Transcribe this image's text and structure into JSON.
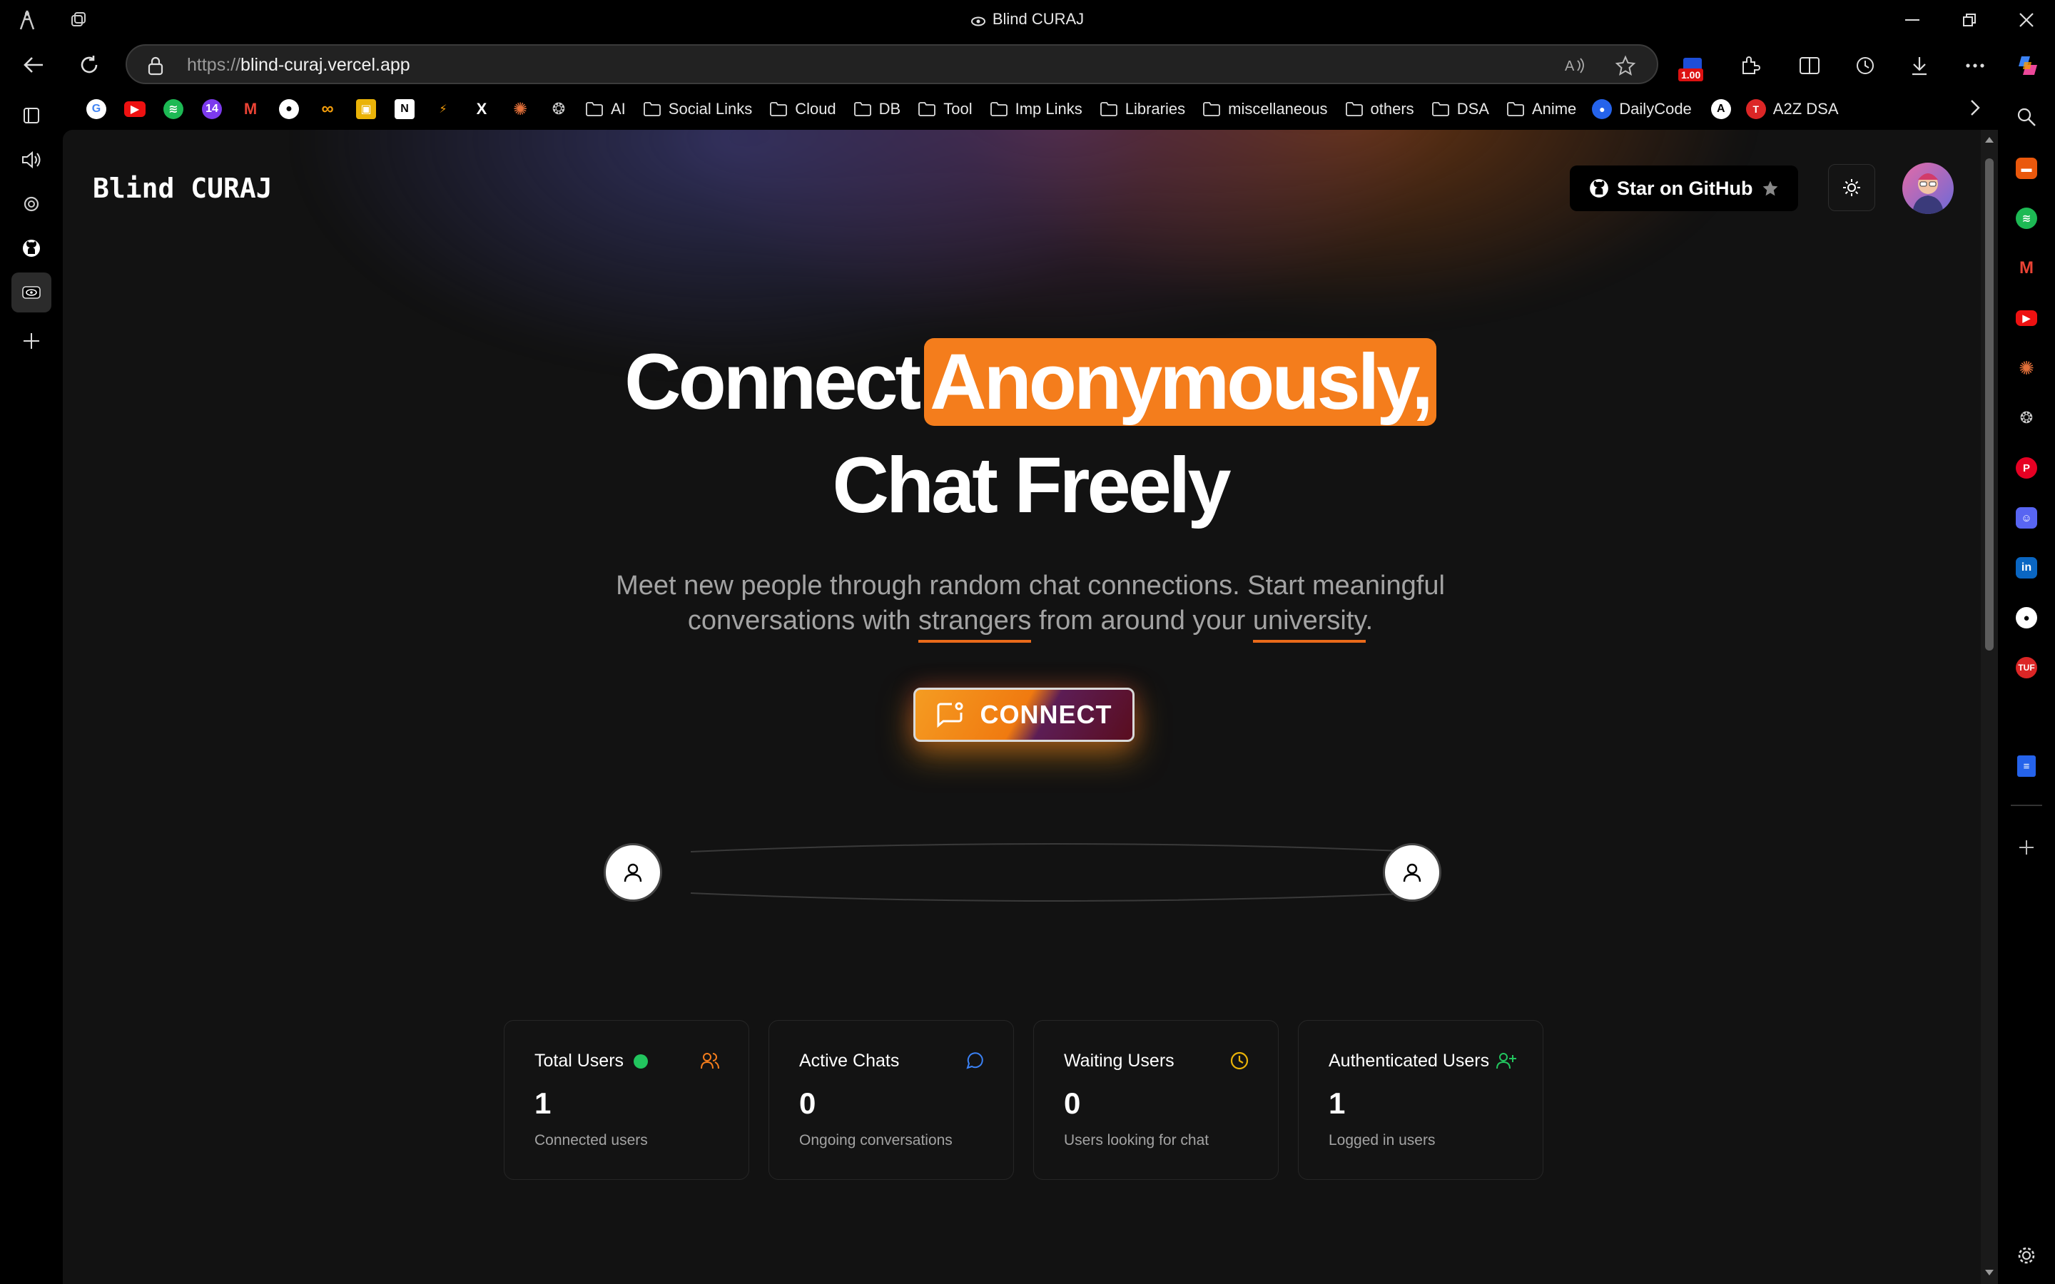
{
  "window": {
    "title": "Blind CURAJ"
  },
  "address_bar": {
    "scheme": "https://",
    "host": "blind-curaj.vercel.app",
    "badge": "1.00"
  },
  "bookmarks": {
    "folders": [
      "AI",
      "Social Links",
      "Cloud",
      "DB",
      "Tool",
      "Imp Links",
      "Libraries",
      "miscellaneous",
      "others",
      "DSA",
      "Anime"
    ],
    "links": [
      {
        "label": "DailyCode"
      },
      {
        "label": "A2Z DSA"
      }
    ]
  },
  "page": {
    "logo": "Blind CURAJ",
    "github_button": "Star on GitHub",
    "hero": {
      "line1_a": "Connect",
      "line1_highlight": "Anonymously,",
      "line2": "Chat Freely"
    },
    "subtitle": {
      "line1": "Meet new people through random chat connections. Start meaningful",
      "line2_a": "conversations with ",
      "line2_u1": "strangers",
      "line2_b": " from around your ",
      "line2_u2": "university",
      "line2_c": "."
    },
    "connect_button": "CONNECT",
    "stats": [
      {
        "label": "Total Users",
        "value": "1",
        "desc": "Connected users",
        "icon": "users-icon",
        "color": "#f47d1c"
      },
      {
        "label": "Active Chats",
        "value": "0",
        "desc": "Ongoing conversations",
        "icon": "message-circle-icon",
        "color": "#3b82f6"
      },
      {
        "label": "Waiting Users",
        "value": "0",
        "desc": "Users looking for chat",
        "icon": "clock-icon",
        "color": "#eab308"
      },
      {
        "label": "Authenticated Users",
        "value": "1",
        "desc": "Logged in users",
        "icon": "user-plus-icon",
        "color": "#22c55e"
      }
    ]
  },
  "colors": {
    "accent": "#f47d1c",
    "online": "#22c55e",
    "background": "#121212"
  }
}
